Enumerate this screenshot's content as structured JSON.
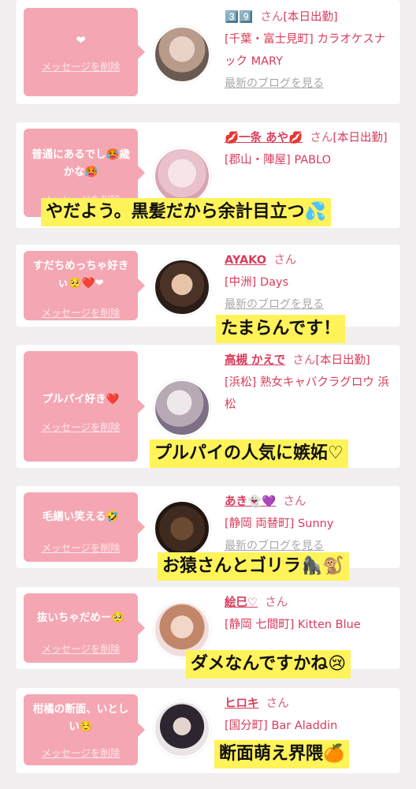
{
  "theme": {
    "bubble": "#f4a7b3",
    "name": "#d93c5c",
    "caption_bg": "#fff35a"
  },
  "cards": [
    {
      "message": "❤",
      "delete_label": "メッセージを削除",
      "name_emoji": "3️⃣9️⃣",
      "san": "さん",
      "tag": "[本日出勤]",
      "area": "[千葉・富士見町]",
      "shop": "カラオケスナック MARY",
      "blog_label": "最新のブログを見る"
    },
    {
      "message": "普通にあるでし🥵歳かな🥵",
      "delete_label": "メッセージを削除",
      "name": "💋一条 あや💋",
      "san": "さん",
      "tag": "[本日出勤]",
      "area": "[郡山・陣屋]",
      "shop": "PABLO",
      "caption": "やだよう。黒髪だから余計目立つ💦"
    },
    {
      "message": "すだちめっちゃ好きぃ🥺❤️❤",
      "delete_label": "メッセージを削除",
      "name": "AYAKO",
      "san": "さん",
      "area": "[中洲]",
      "shop": "Days",
      "blog_label": "最新のブログを見る",
      "caption": "たまらんです！"
    },
    {
      "message": "プルパイ好き❤️",
      "delete_label": "メッセージを削除",
      "name": "高槻 かえで",
      "san": "さん",
      "tag": "[本日出勤]",
      "area": "[浜松]",
      "shop": "熟女キャバクラグロウ 浜松",
      "caption": "プルパイの人気に嫉妬♡"
    },
    {
      "message": "毛繕い笑える🤣",
      "delete_label": "メッセージを削除",
      "name": "あき👻💜",
      "san": "さん",
      "area": "[静岡 両替町]",
      "shop": "Sunny",
      "blog_label": "最新のブログを見る",
      "caption": "お猿さんとゴリラ🦍🐒"
    },
    {
      "message": "抜いちゃだめー🥺",
      "delete_label": "メッセージを削除",
      "name": "絵巳♡",
      "san": "さん",
      "area": "[静岡 七間町]",
      "shop": "Kitten Blue",
      "caption": "ダメなんですかね😢"
    },
    {
      "message": "柑橘の断面、いとしい☺️",
      "delete_label": "メッセージを削除",
      "name": "ヒロキ",
      "san": "さん",
      "area": "[国分町]",
      "shop": "Bar Aladdin",
      "caption": "断面萌え界隈🍊"
    }
  ]
}
